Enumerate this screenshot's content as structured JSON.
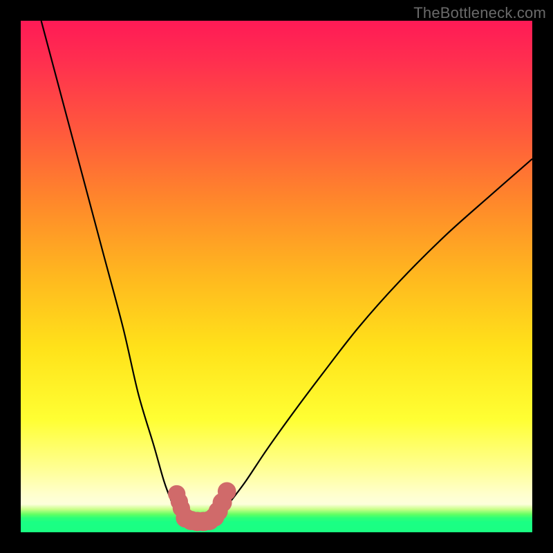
{
  "watermark": "TheBottleneck.com",
  "chart_data": {
    "type": "line",
    "title": "",
    "xlabel": "",
    "ylabel": "",
    "xlim": [
      0,
      100
    ],
    "ylim": [
      0,
      100
    ],
    "grid": false,
    "series": [
      {
        "name": "left-branch",
        "x": [
          4,
          8,
          12,
          16,
          20,
          23,
          26,
          28,
          29.5,
          30.7,
          31.5
        ],
        "y": [
          100,
          85,
          70,
          55,
          40,
          27,
          17,
          10,
          6,
          3.5,
          2.5
        ]
      },
      {
        "name": "right-branch",
        "x": [
          38,
          39.5,
          41,
          44,
          48,
          53,
          59,
          66,
          74,
          83,
          92,
          100
        ],
        "y": [
          2.5,
          4,
          6,
          10,
          16,
          23,
          31,
          40,
          49,
          58,
          66,
          73
        ]
      }
    ],
    "markers": {
      "name": "bottom-points",
      "color": "#d06a6a",
      "points": [
        {
          "x": 30.5,
          "y": 7.5,
          "r": 1.3
        },
        {
          "x": 31.0,
          "y": 6.0,
          "r": 1.3
        },
        {
          "x": 31.4,
          "y": 4.7,
          "r": 1.3
        },
        {
          "x": 32.2,
          "y": 2.8,
          "r": 1.5
        },
        {
          "x": 33.3,
          "y": 2.3,
          "r": 1.5
        },
        {
          "x": 34.5,
          "y": 2.1,
          "r": 1.5
        },
        {
          "x": 35.7,
          "y": 2.1,
          "r": 1.5
        },
        {
          "x": 36.9,
          "y": 2.3,
          "r": 1.5
        },
        {
          "x": 37.9,
          "y": 3.0,
          "r": 1.5
        },
        {
          "x": 38.6,
          "y": 4.1,
          "r": 1.5
        },
        {
          "x": 39.4,
          "y": 5.8,
          "r": 1.5
        },
        {
          "x": 40.3,
          "y": 8.0,
          "r": 1.4
        }
      ]
    },
    "colors": {
      "curve": "#000000",
      "markers": "#d06a6a"
    }
  }
}
